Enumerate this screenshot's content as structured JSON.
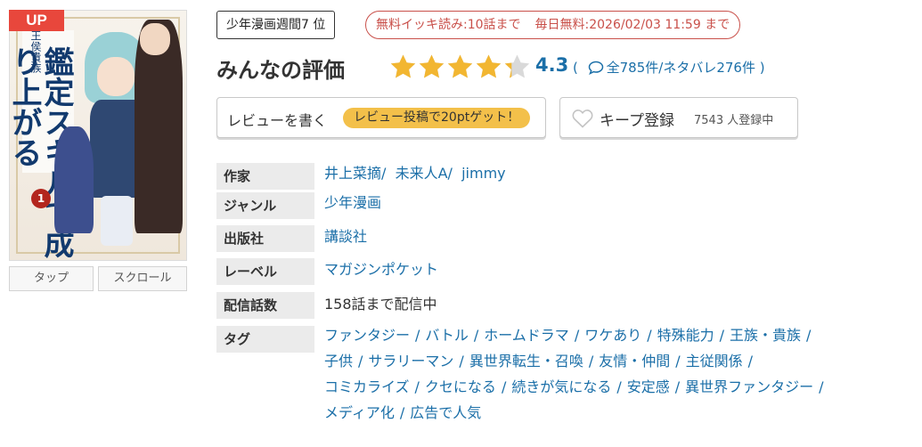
{
  "cover": {
    "up_badge": "UP",
    "title_small": "王侯貴族",
    "title_main": "鑑定スキルで成り上がる",
    "volume": "1",
    "buttons": {
      "tap": "タップ",
      "scroll": "スクロール"
    }
  },
  "badges": {
    "rank_prefix": "少年漫画週間",
    "rank_number": "7",
    "rank_suffix": " 位",
    "free_read": "無料イッキ読み:10話まで",
    "daily_free": "毎日無料:2026/02/03 11:59 まで"
  },
  "rating": {
    "title": "みんなの評価",
    "score": "4.3",
    "score_value": 4.3,
    "stars_max": 5,
    "counts_open": "(",
    "counts_text": "全785件/ネタバレ276件",
    "counts_close": ")"
  },
  "review_button": {
    "label": "レビューを書く",
    "pill": "レビュー投稿で20ptゲット！"
  },
  "keep_button": {
    "label": "キープ登録",
    "count": "7543 人登録中"
  },
  "info": {
    "author_label": "作家",
    "authors": [
      "井上菜摘",
      "未来人A",
      "jimmy"
    ],
    "genre_label": "ジャンル",
    "genre": "少年漫画",
    "publisher_label": "出版社",
    "publisher": "講談社",
    "label_label": "レーベル",
    "label": "マガジンポケット",
    "episodes_label": "配信話数",
    "episodes": "158話まで配信中",
    "tags_label": "タグ",
    "tags": [
      [
        "ファンタジー",
        "バトル",
        "ホームドラマ",
        "ワケあり",
        "特殊能力",
        "王族・貴族"
      ],
      [
        "子供",
        "サラリーマン",
        "異世界転生・召喚",
        "友情・仲間",
        "主従関係"
      ],
      [
        "コミカライズ",
        "クセになる",
        "続きが気になる",
        "安定感",
        "異世界ファンタジー"
      ],
      [
        "メディア化",
        "広告で人気"
      ]
    ]
  },
  "colors": {
    "link": "#1b6fa8",
    "star": "#f2b631",
    "up_badge": "#e8473c",
    "free_badge": "#c9504a",
    "pill": "#f3c04a"
  }
}
